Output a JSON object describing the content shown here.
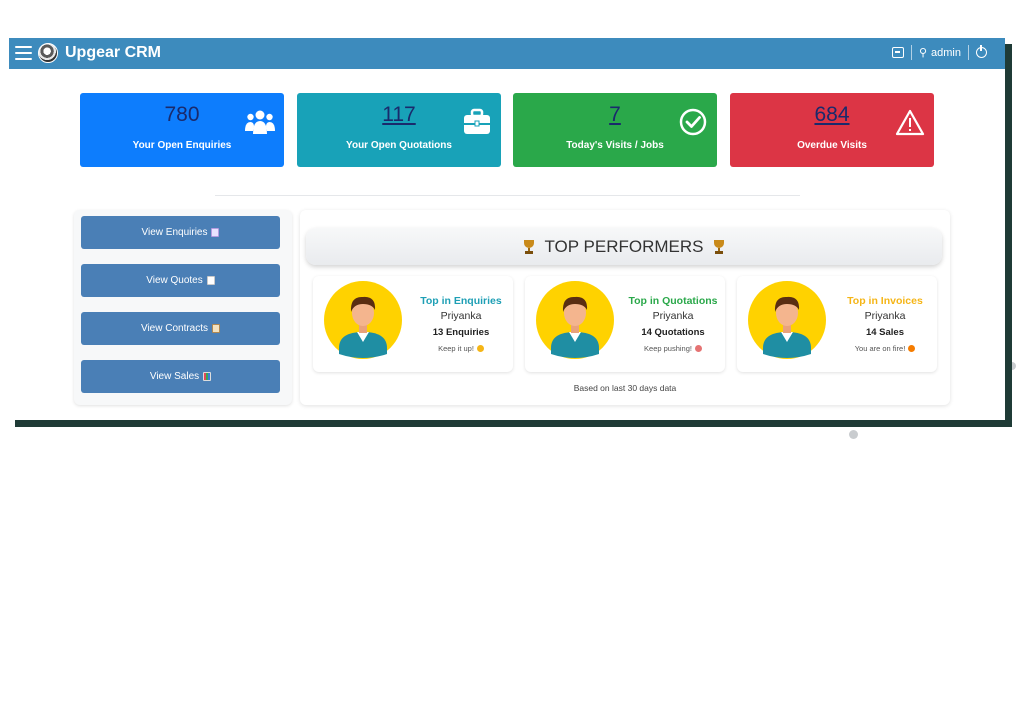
{
  "app": {
    "title": "Upgear CRM",
    "user": "admin"
  },
  "colors": {
    "topbar": "#3d8bbd",
    "enquiries": "#0d7dfd",
    "quotations": "#18a2b8",
    "visits": "#2aa84a",
    "overdue": "#dc3545",
    "nav_button": "#4a7fb6"
  },
  "stats": [
    {
      "value": "780",
      "label": "Your Open Enquiries",
      "icon": "users-icon"
    },
    {
      "value": "117",
      "label": "Your Open Quotations",
      "icon": "briefcase-icon"
    },
    {
      "value": "7",
      "label": "Today's Visits / Jobs",
      "icon": "check-circle-icon"
    },
    {
      "value": "684",
      "label": "Overdue Visits",
      "icon": "warning-icon"
    }
  ],
  "nav": [
    {
      "label": "View Enquiries"
    },
    {
      "label": "View Quotes"
    },
    {
      "label": "View Contracts"
    },
    {
      "label": "View Sales"
    }
  ],
  "performers": {
    "title": "TOP PERFORMERS",
    "cards": [
      {
        "title": "Top in Enquiries",
        "name": "Priyanka",
        "count": "13 Enquiries",
        "note": "Keep it up!",
        "color": "#1e9fb5"
      },
      {
        "title": "Top in Quotations",
        "name": "Priyanka",
        "count": "14 Quotations",
        "note": "Keep pushing!",
        "color": "#2aa84a"
      },
      {
        "title": "Top in Invoices",
        "name": "Priyanka",
        "count": "14 Sales",
        "note": "You are on fire!",
        "color": "#f5b516"
      }
    ],
    "footnote": "Based on last 30 days data"
  }
}
